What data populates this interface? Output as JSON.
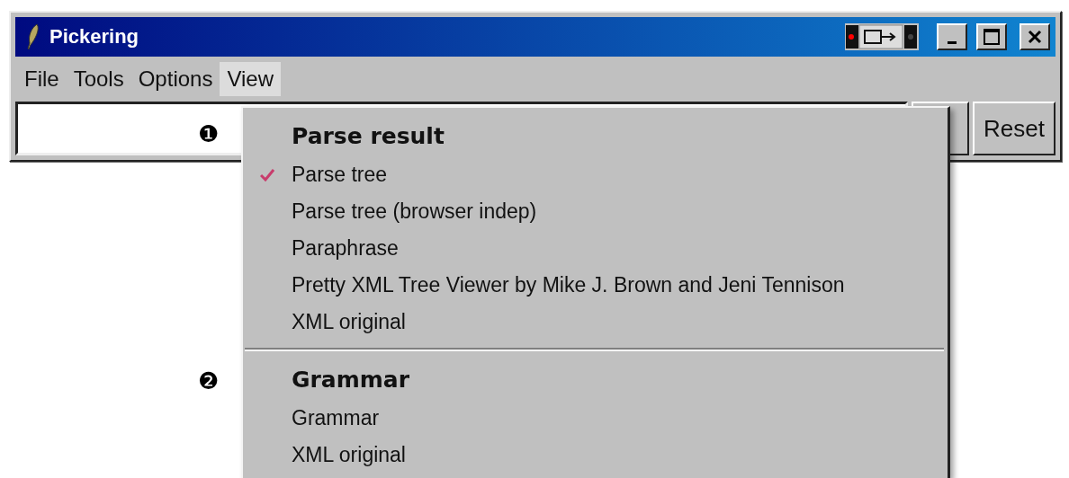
{
  "window": {
    "title": "Pickering"
  },
  "menu_bar": [
    {
      "label": "File",
      "selected": false
    },
    {
      "label": "Tools",
      "selected": false
    },
    {
      "label": "Options",
      "selected": false
    },
    {
      "label": "View",
      "selected": true
    }
  ],
  "toolbar": {
    "buttons": [
      "Reset"
    ]
  },
  "callouts": [
    "❶",
    "❷"
  ],
  "dropdown": {
    "sections": [
      {
        "header": "Parse result",
        "items": [
          {
            "label": "Parse tree",
            "checked": true
          },
          {
            "label": "Parse tree (browser indep)",
            "checked": false
          },
          {
            "label": "Paraphrase",
            "checked": false
          },
          {
            "label": "Pretty XML Tree Viewer by Mike J. Brown and Jeni Tennison",
            "checked": false
          },
          {
            "label": "XML original",
            "checked": false
          }
        ]
      },
      {
        "header": "Grammar",
        "items": [
          {
            "label": "Grammar",
            "checked": false
          },
          {
            "label": "XML original",
            "checked": false
          }
        ]
      }
    ]
  }
}
